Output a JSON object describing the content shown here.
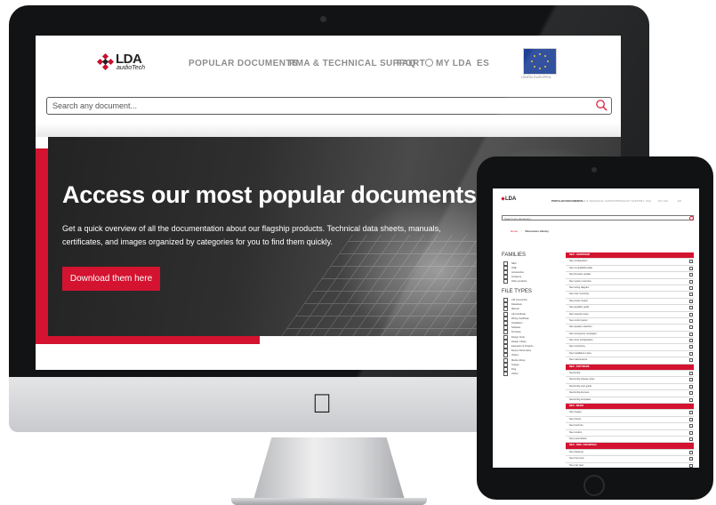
{
  "site": {
    "logo_text": "LDA",
    "logo_subtext": "audioTech",
    "nav": [
      {
        "label": "POPULAR DOCUMENTS"
      },
      {
        "label": "RMA & TECHNICAL SUPPORT"
      },
      {
        "label": "FAQ"
      },
      {
        "label": "MY LDA"
      },
      {
        "label": "ES"
      }
    ],
    "eu_caption": "UNIÓN EUROPEA",
    "search": {
      "placeholder": "Search any document..."
    },
    "hero": {
      "title": "Access our most popular documents",
      "description": "Get a quick overview of all the documentation about our flagship products. Technical data sheets, manuals, certificates, and images organized by categories for you to find them quickly.",
      "button_label": "Download them here"
    },
    "colors": {
      "accent": "#d3132f",
      "text_dark": "#222222",
      "nav_gray": "#8d8d8d"
    }
  },
  "tablet": {
    "logo_text": "LDA",
    "nav": [
      "POPULAR DOCUMENTS",
      "RMA & TECHNICAL SUPPORT",
      "PRODUCT SUPPORT",
      "FAQ",
      "MY LDA",
      "ES"
    ],
    "search_placeholder": "Search any document...",
    "breadcrumb": [
      "Home",
      "Resources Library"
    ],
    "families_heading": "FAMILIES",
    "families": [
      "NEO",
      "ONE",
      "Accessories",
      "Amateurs",
      "Other products"
    ],
    "file_types_heading": "FILE TYPES",
    "file_types": [
      "CM Connection",
      "Datasheet",
      "Manual",
      "CE Certificate",
      "Wiring Certificate",
      "Installation",
      "Software",
      "Firmware",
      "Design Tools",
      "Design Library",
      "Examples of Projects",
      "Device Schematics",
      "Videos",
      "Media Library",
      "Images",
      "Dwg",
      "Others"
    ],
    "groups": [
      {
        "heading": "NEO - HARDWARE",
        "rows": [
          "Neo configuration",
          "Neo compatibility table",
          "Neo firmware update",
          "Neo system overview",
          "Neo wiring diagram",
          "Neo rack mounting",
          "Neo power supply",
          "Neo amplifier guide",
          "Neo network setup",
          "Neo control panel",
          "Neo speaker selection",
          "Neo emergency messages",
          "Neo zone configuration",
          "Neo monitoring",
          "Neo installation notes",
          "Neo maintenance"
        ]
      },
      {
        "heading": "NEO - SOFTWARE",
        "rows": [
          "NeoConfig",
          "NeoConfig release notes",
          "NeoConfig user guide",
          "NeoConfig licenses",
          "NeoConfig templates"
        ]
      },
      {
        "heading": "NEO - MEDIA",
        "rows": [
          "Neo images",
          "Neo photos",
          "Neo brochure",
          "Neo renders",
          "Neo presentation"
        ]
      },
      {
        "heading": "NEO - DWG / DRAWINGS",
        "rows": [
          "Neo drawings",
          "Neo front view",
          "Neo rear view",
          "Neo top view"
        ]
      }
    ]
  }
}
